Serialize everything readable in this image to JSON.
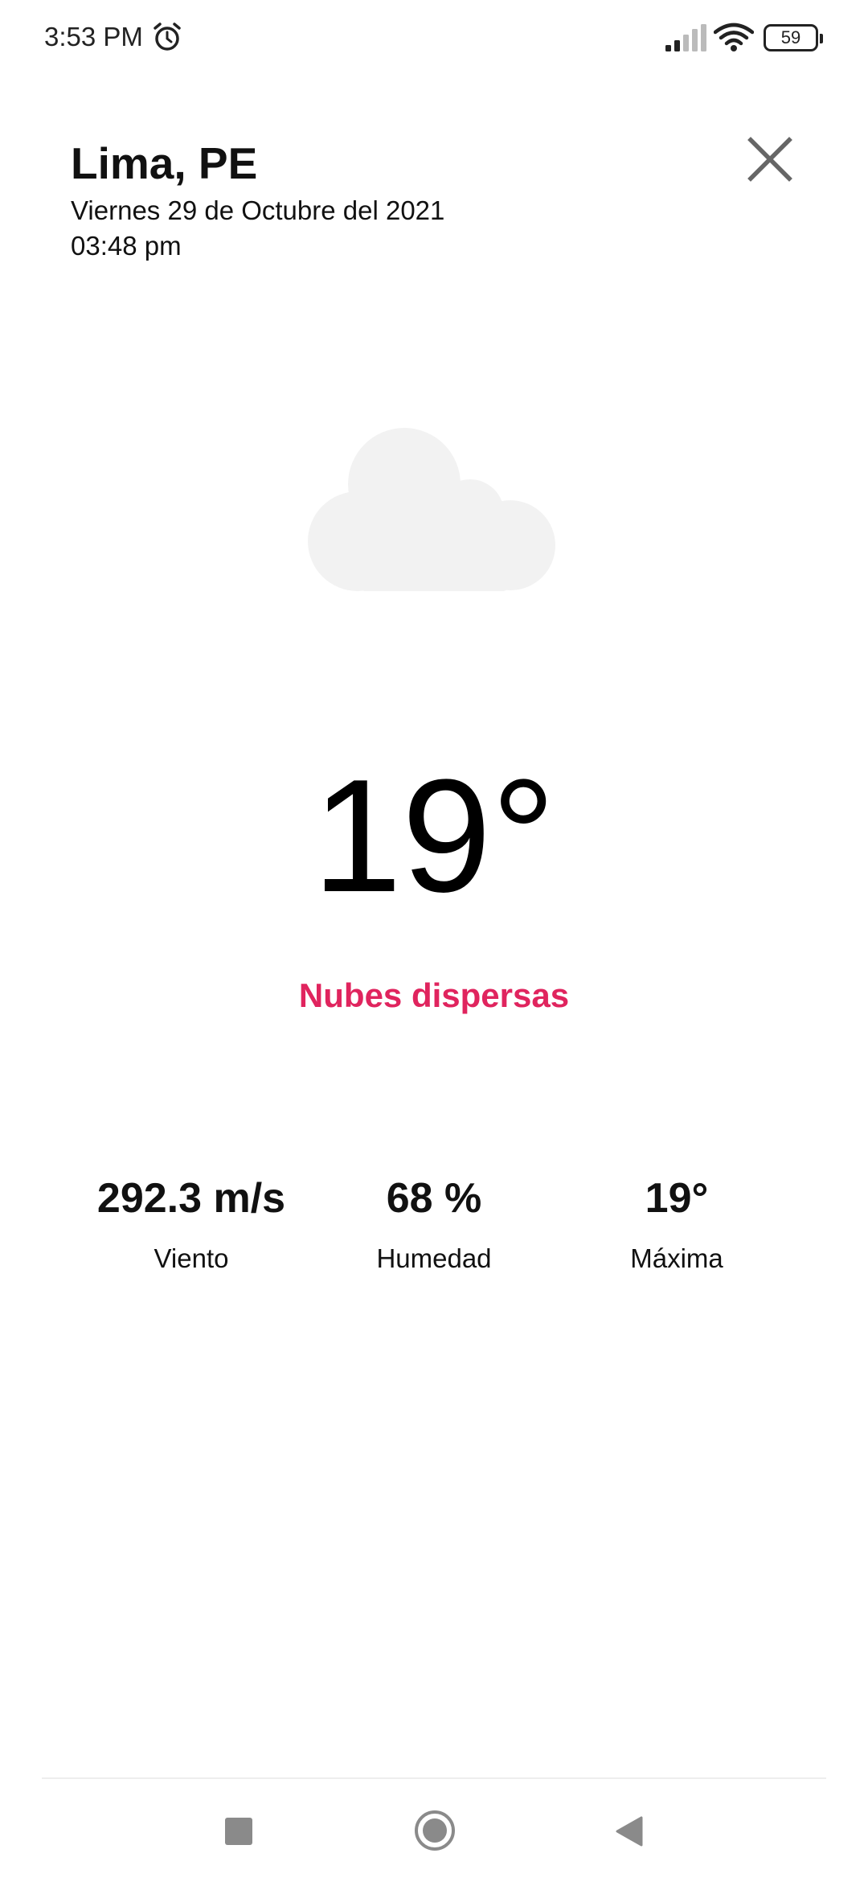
{
  "status_bar": {
    "time": "3:53 PM",
    "battery": "59",
    "icons": [
      "alarm-icon",
      "signal-icon",
      "wifi-icon",
      "battery-icon"
    ]
  },
  "header": {
    "city": "Lima, PE",
    "date": "Viernes 29 de Octubre del 2021",
    "time": "03:48 pm",
    "close_icon": "close-icon"
  },
  "weather": {
    "icon": "cloud-icon",
    "temperature": "19°",
    "description": "Nubes dispersas",
    "description_color": "#e0245e"
  },
  "stats": {
    "wind": {
      "value": "292.3 m/s",
      "label": "Viento"
    },
    "humidity": {
      "value": "68 %",
      "label": "Humedad"
    },
    "max": {
      "value": "19°",
      "label": "Máxima"
    }
  },
  "nav": {
    "icons": [
      "recents-icon",
      "home-icon",
      "back-icon"
    ]
  }
}
